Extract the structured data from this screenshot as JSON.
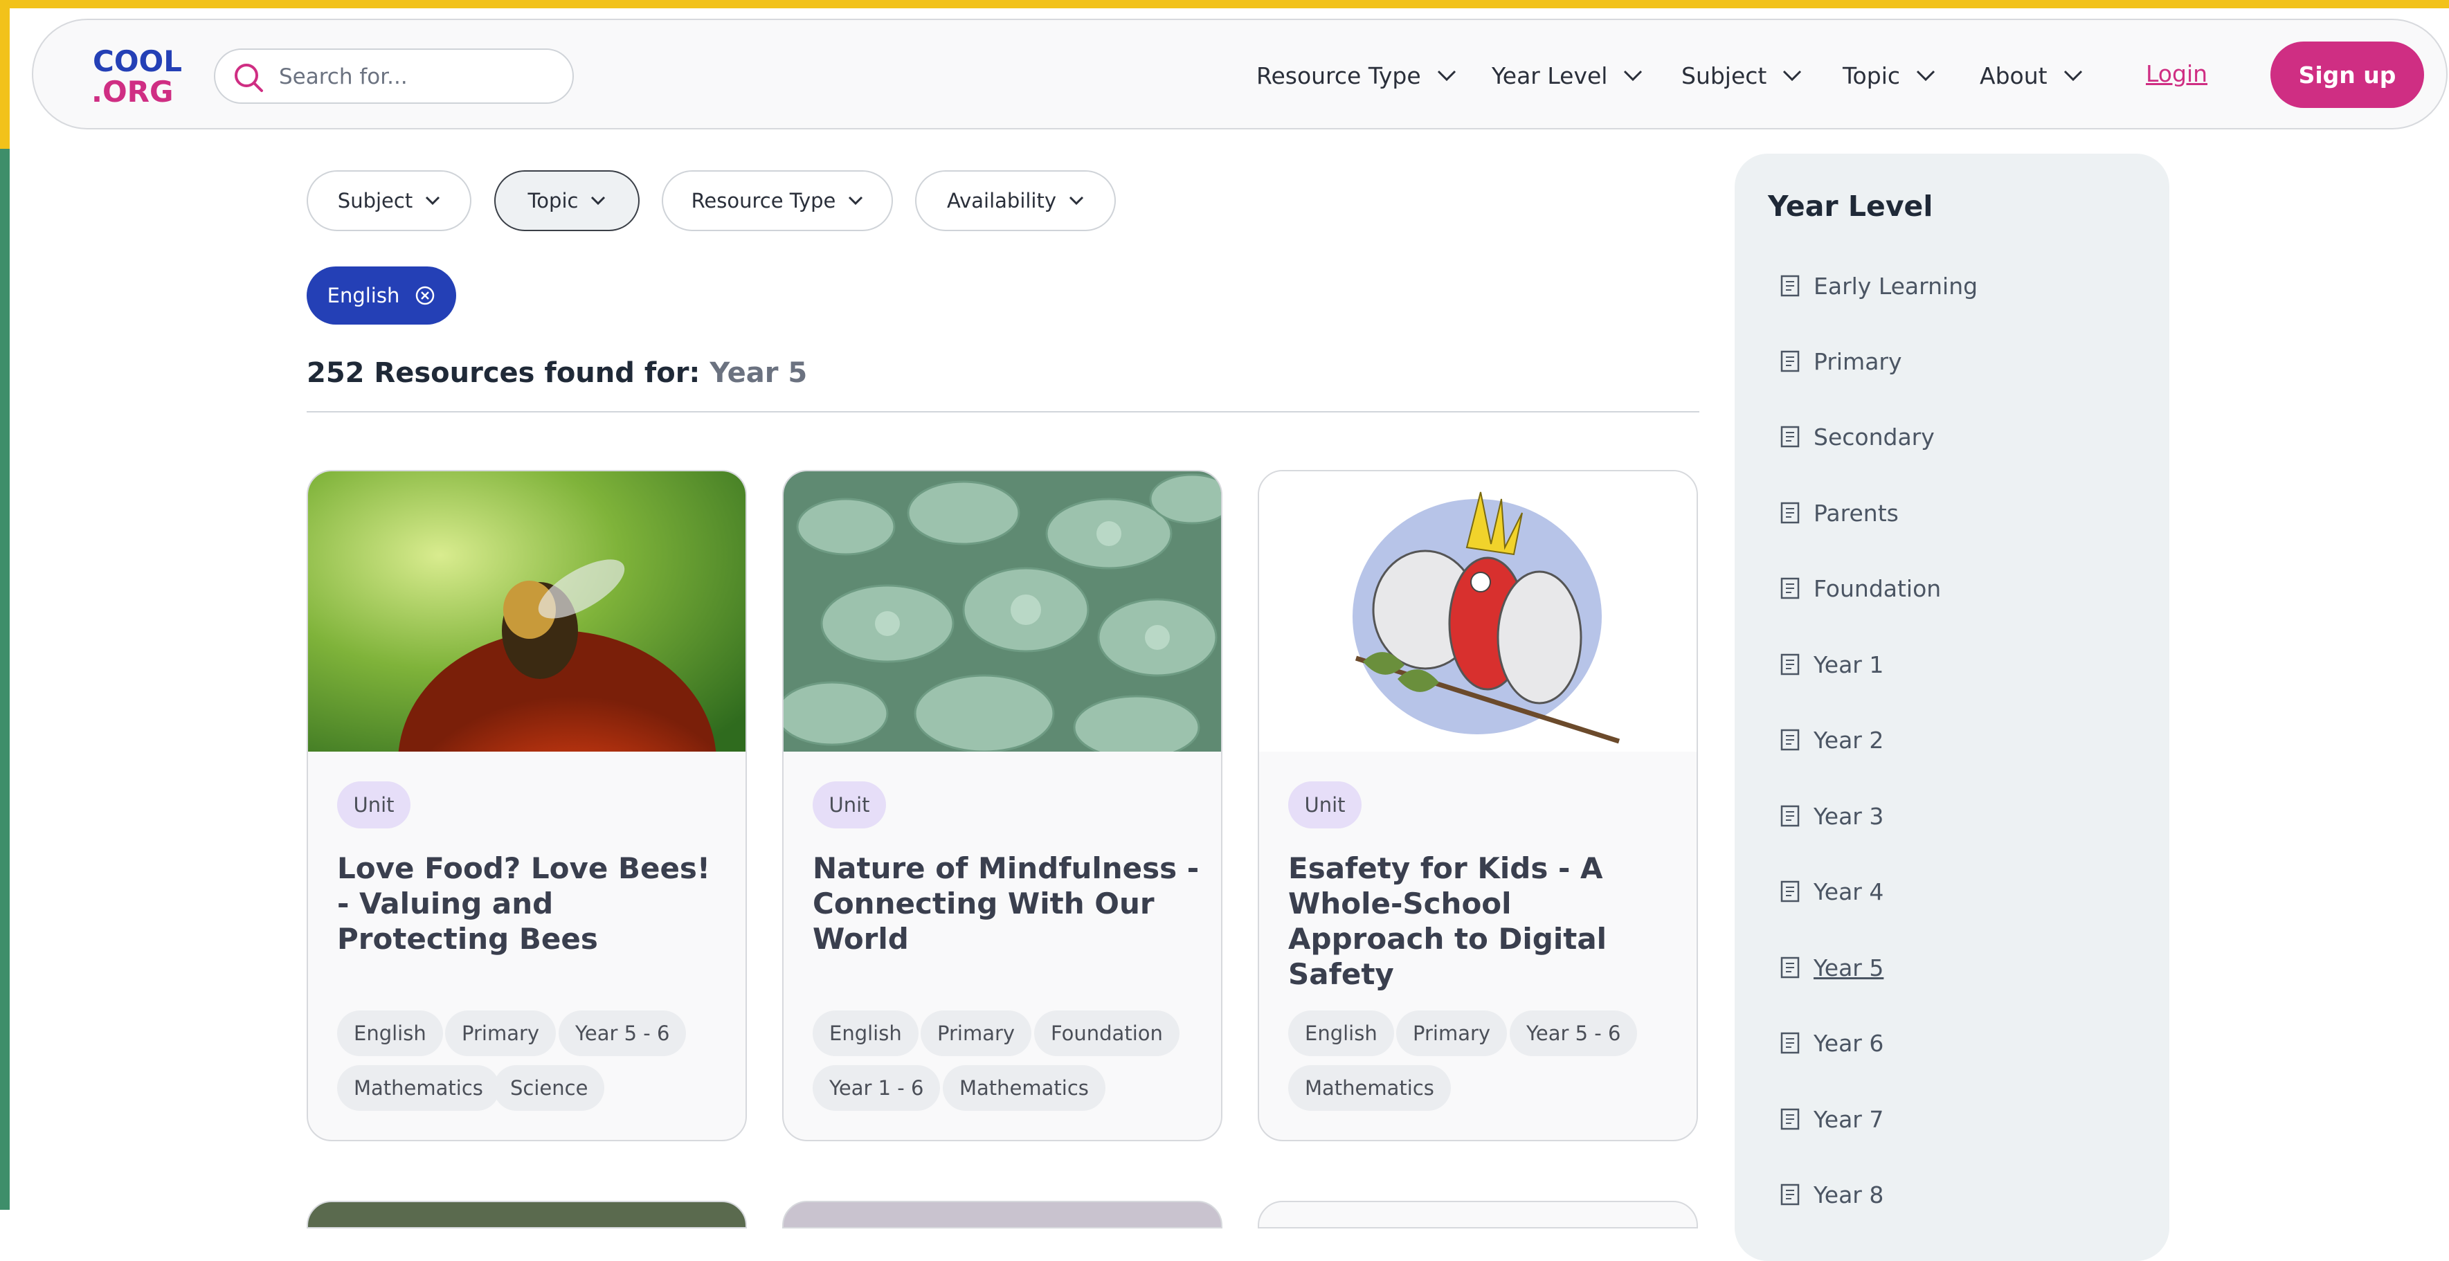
{
  "brand": {
    "logo_text_top": "COOL",
    "logo_text_bottom": ".ORG",
    "accent": "#cf2e83",
    "blue": "#2440b6"
  },
  "search": {
    "placeholder": "Search for..."
  },
  "nav": {
    "items": [
      {
        "label": "Resource Type"
      },
      {
        "label": "Year Level"
      },
      {
        "label": "Subject"
      },
      {
        "label": "Topic"
      },
      {
        "label": "About"
      }
    ],
    "login": "Login",
    "signup": "Sign up"
  },
  "filters": [
    {
      "label": "Subject"
    },
    {
      "label": "Topic"
    },
    {
      "label": "Resource Type"
    },
    {
      "label": "Availability"
    }
  ],
  "active_filter_chip": {
    "label": "English",
    "icon": "close-circle-icon"
  },
  "results": {
    "count_text": "252 Resources found for:",
    "query": "Year 5"
  },
  "cards": [
    {
      "type": "Unit",
      "title": "Love Food? Love Bees! - Valuing and Protecting Bees",
      "image": "bee-on-flower",
      "tags": [
        "English",
        "Primary",
        "Year 5 - 6",
        "Mathematics",
        "Science"
      ]
    },
    {
      "type": "Unit",
      "title": "Nature of Mindfulness - Connecting With Our World",
      "image": "succulent-plants",
      "tags": [
        "English",
        "Primary",
        "Foundation",
        "Year 1 - 6",
        "Mathematics"
      ]
    },
    {
      "type": "Unit",
      "title": "Esafety for Kids - A Whole-School Approach to Digital Safety",
      "image": "cockatoo-drawing",
      "tags": [
        "English",
        "Primary",
        "Year 5 - 6",
        "Mathematics"
      ]
    }
  ],
  "sidebar": {
    "title": "Year Level",
    "items": [
      {
        "label": "Early Learning"
      },
      {
        "label": "Primary"
      },
      {
        "label": "Secondary"
      },
      {
        "label": "Parents"
      },
      {
        "label": "Foundation"
      },
      {
        "label": "Year 1"
      },
      {
        "label": "Year 2"
      },
      {
        "label": "Year 3"
      },
      {
        "label": "Year 4"
      },
      {
        "label": "Year 5"
      },
      {
        "label": "Year 6"
      },
      {
        "label": "Year 7"
      },
      {
        "label": "Year 8"
      }
    ]
  }
}
